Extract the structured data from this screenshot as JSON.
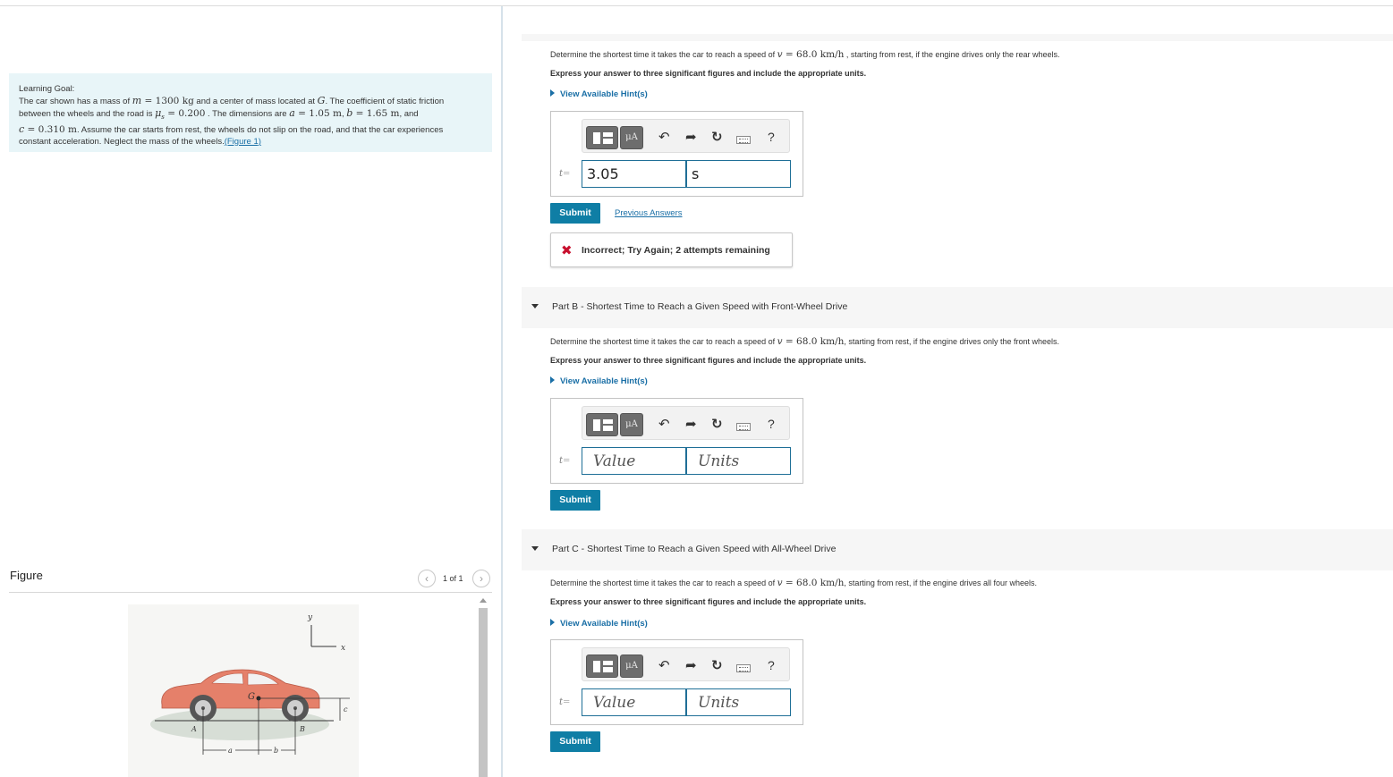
{
  "left": {
    "learning_goal": {
      "title": "Learning Goal:",
      "t1": "The car shown has a mass of ",
      "m_sym": "m",
      "m_eq": " = 1300 kg",
      "t2": " and a center of mass  located at ",
      "g_sym": "G",
      "t3": ". The coefficient of static friction",
      "t4": "between the wheels and the road is ",
      "mu_sym": "μ",
      "mu_sub": "s",
      "mu_eq": " = 0.200",
      "t5": " . The dimensions are ",
      "a_sym": "a",
      "a_eq": " = 1.05 m",
      "sep1": ", ",
      "b_sym": "b",
      "b_eq": " = 1.65 m",
      "t6": ", and",
      "c_sym": "c",
      "c_eq": " = 0.310 m",
      "t7": ". Assume the car starts from rest, the wheels do not slip on the road, and that the car experiences",
      "t8": "constant acceleration. Neglect the mass of the wheels.",
      "figure_link": "(Figure 1)"
    },
    "figure": {
      "label": "Figure",
      "counter": "1 of 1",
      "prev_icon": "chevron-left-icon",
      "next_icon": "chevron-right-icon",
      "labels": {
        "y": "y",
        "x": "x",
        "g": "G",
        "a_pt": "A",
        "b_pt": "B",
        "a_dim": "a",
        "b_dim": "b",
        "c_dim": "c"
      },
      "car_color": "#e5806a"
    }
  },
  "right": {
    "partA": {
      "q_pre": "Determine the shortest time it takes the car to reach a speed of ",
      "v_sym": "v",
      "v_eq": " = 68.0 km/h",
      "q_post": " , starting from rest, if the engine drives only the rear wheels.",
      "express": "Express your answer to three significant figures and include the appropriate units.",
      "hint": "View Available Hint(s)",
      "var_label": "t",
      "eq": "=",
      "value": "3.05",
      "units": "s",
      "submit": "Submit",
      "previous_answers": "Previous Answers",
      "feedback": "Incorrect; Try Again; 2 attempts remaining"
    },
    "partB": {
      "title": "Part B - Shortest Time to Reach a Given Speed with Front-Wheel Drive",
      "q_pre": "Determine the shortest time it takes the car to reach a speed of ",
      "v_sym": "v",
      "v_eq": " = 68.0 km/h",
      "q_post": ", starting from rest, if the engine drives only the front wheels.",
      "express": "Express your answer to three significant figures and include the appropriate units.",
      "hint": "View Available Hint(s)",
      "var_label": "t",
      "eq": "=",
      "value_placeholder": "Value",
      "units_placeholder": "Units",
      "submit": "Submit"
    },
    "partC": {
      "title": "Part C - Shortest Time to Reach a Given Speed with All-Wheel Drive",
      "q_pre": "Determine the shortest time it takes the car to reach a speed of ",
      "v_sym": "v",
      "v_eq": " = 68.0 km/h",
      "q_post": ", starting from rest, if the engine drives all four wheels.",
      "express": "Express your answer to three significant figures and include the appropriate units.",
      "hint": "View Available Hint(s)",
      "var_label": "t",
      "eq": "=",
      "value_placeholder": "Value",
      "units_placeholder": "Units",
      "submit": "Submit"
    },
    "toolbar": {
      "mu_label": "μA",
      "undo_icon": "undo-icon",
      "redo_icon": "redo-icon",
      "reset_icon": "reset-icon",
      "keyboard_icon": "keyboard-icon",
      "help": "?"
    }
  },
  "colors": {
    "accent": "#0f7ea5",
    "link": "#1a6fa6",
    "error": "#c8102e",
    "goal_bg": "#e8f5f8"
  }
}
